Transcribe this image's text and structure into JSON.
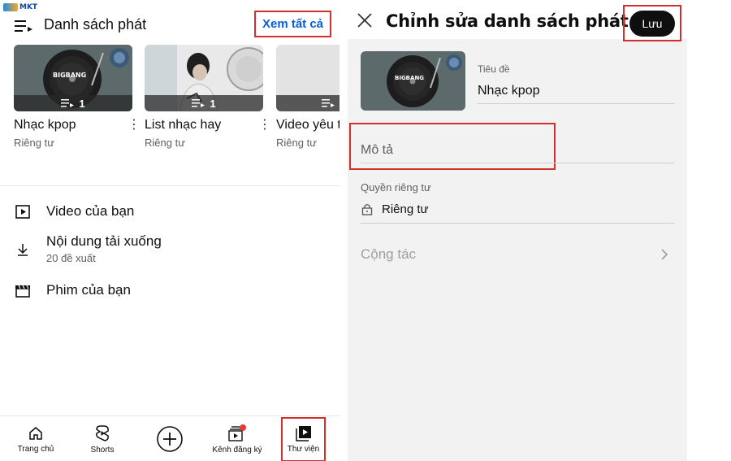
{
  "left": {
    "logo_text": "MKT",
    "header": {
      "title": "Danh sách phát",
      "see_all": "Xem tất cả"
    },
    "playlists": [
      {
        "title": "Nhạc kpop",
        "privacy": "Riêng tư",
        "count": "1",
        "thumb_text": "BIGBANG"
      },
      {
        "title": "List nhạc hay",
        "privacy": "Riêng tư",
        "count": "1"
      },
      {
        "title": "Video yêu thích",
        "privacy": "Riêng tư",
        "count": ""
      }
    ],
    "library": [
      {
        "label": "Video của bạn",
        "sub": ""
      },
      {
        "label": "Nội dung tải xuống",
        "sub": "20 đề xuất"
      },
      {
        "label": "Phim của bạn",
        "sub": ""
      }
    ],
    "nav": [
      {
        "label": "Trang chủ"
      },
      {
        "label": "Shorts"
      },
      {
        "label": ""
      },
      {
        "label": "Kênh đăng ký"
      },
      {
        "label": "Thư viện"
      }
    ]
  },
  "right": {
    "title": "Chỉnh sửa danh sách phát",
    "save": "Lưu",
    "thumb_text": "BIGBANG",
    "title_field": {
      "label": "Tiêu đề",
      "value": "Nhạc kpop"
    },
    "description_field": {
      "placeholder": "Mô tả"
    },
    "privacy_field": {
      "label": "Quyền riêng tư",
      "value": "Riêng tư"
    },
    "collaborate": "Cộng tác"
  },
  "colors": {
    "highlight": "#d32f2f",
    "link": "#065fd4",
    "notification": "#e53935"
  }
}
